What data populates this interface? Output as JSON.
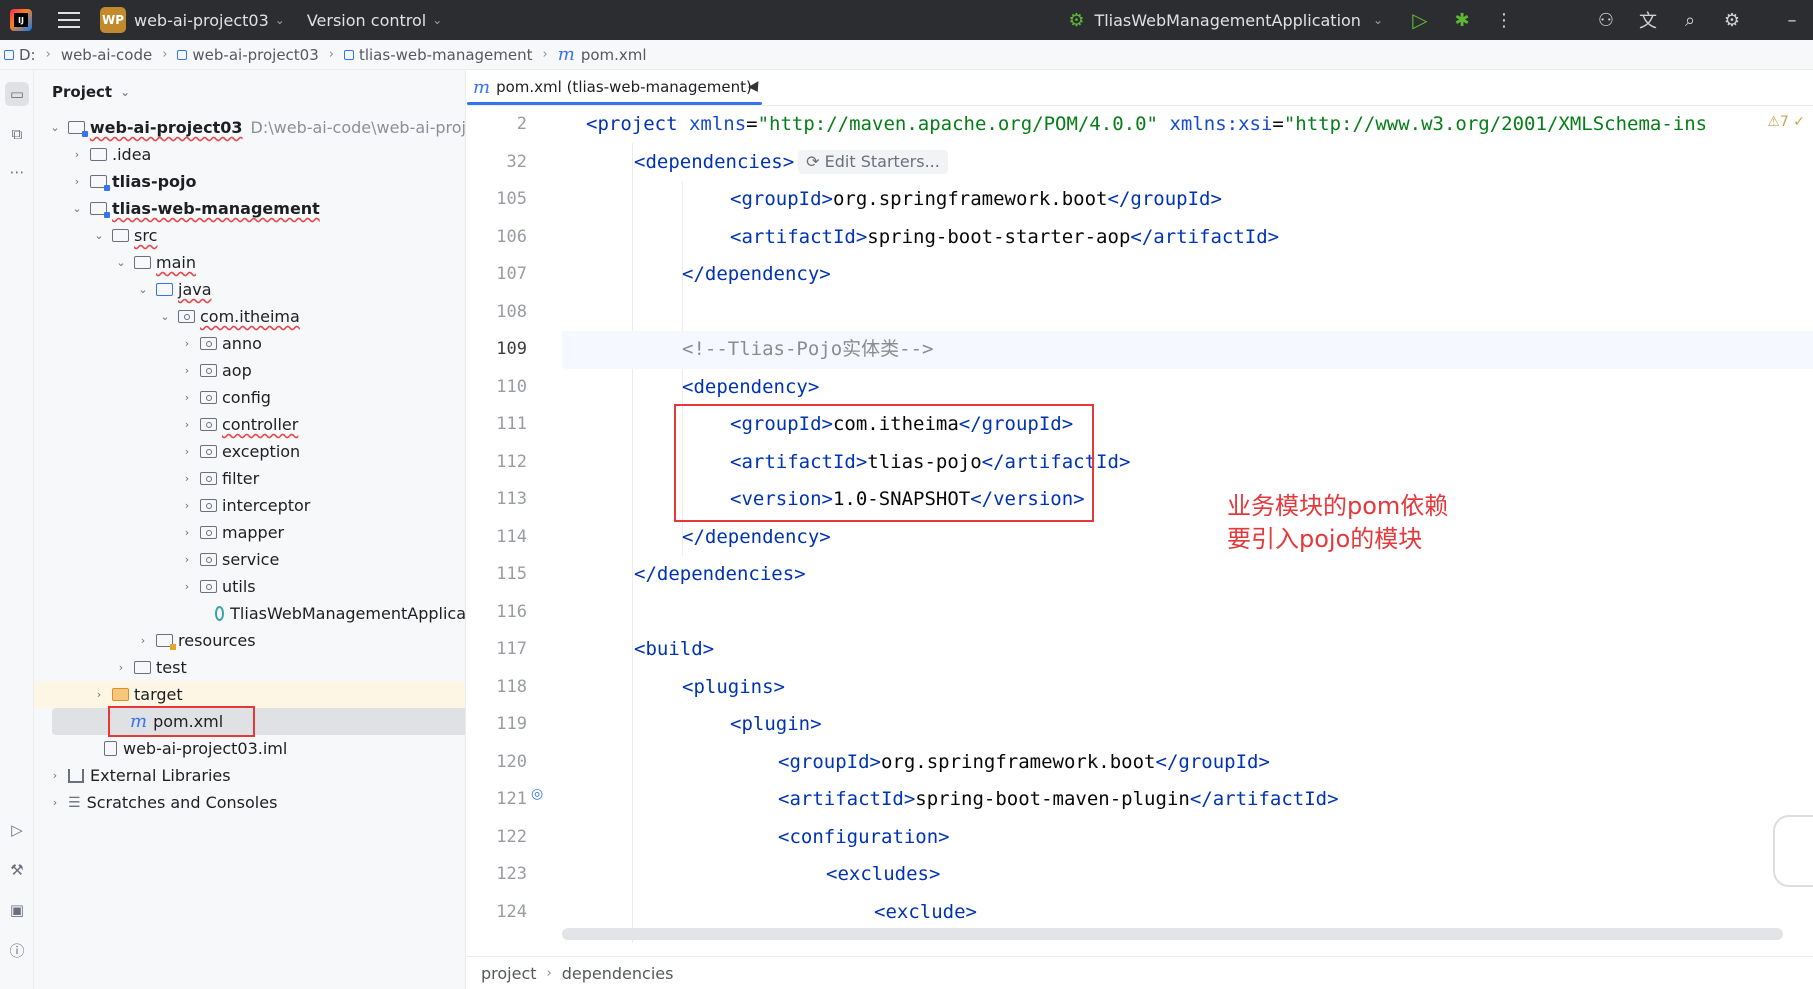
{
  "titlebar": {
    "project_badge": "WP",
    "project_name": "web-ai-project03",
    "version_control": "Version control",
    "run_config": "TliasWebManagementApplication"
  },
  "breadcrumb": [
    "D:",
    "web-ai-code",
    "web-ai-project03",
    "tlias-web-management",
    "pom.xml"
  ],
  "project_panel": {
    "title": "Project",
    "tree": [
      {
        "label": "web-ai-project03",
        "path": "D:\\web-ai-code\\web-ai-proj"
      },
      {
        "label": ".idea"
      },
      {
        "label": "tlias-pojo"
      },
      {
        "label": "tlias-web-management"
      },
      {
        "label": "src"
      },
      {
        "label": "main"
      },
      {
        "label": "java"
      },
      {
        "label": "com.itheima"
      },
      {
        "label": "anno"
      },
      {
        "label": "aop"
      },
      {
        "label": "config"
      },
      {
        "label": "controller"
      },
      {
        "label": "exception"
      },
      {
        "label": "filter"
      },
      {
        "label": "interceptor"
      },
      {
        "label": "mapper"
      },
      {
        "label": "service"
      },
      {
        "label": "utils"
      },
      {
        "label": "TliasWebManagementApplica"
      },
      {
        "label": "resources"
      },
      {
        "label": "test"
      },
      {
        "label": "target"
      },
      {
        "label": "pom.xml"
      },
      {
        "label": "web-ai-project03.iml"
      },
      {
        "label": "External Libraries"
      },
      {
        "label": "Scratches and Consoles"
      }
    ]
  },
  "editor": {
    "tab_label": "pom.xml (tlias-web-management)",
    "warning_count": "7",
    "edit_starters": "Edit Starters...",
    "line_numbers": [
      "2",
      "32",
      "105",
      "106",
      "107",
      "108",
      "109",
      "110",
      "111",
      "112",
      "113",
      "114",
      "115",
      "116",
      "117",
      "118",
      "119",
      "120",
      "121",
      "122",
      "123",
      "124"
    ],
    "annotation_line1": "业务模块的pom依赖",
    "annotation_line2": "要引入pojo的模块",
    "footer_crumbs": [
      "project",
      "dependencies"
    ]
  },
  "code": {
    "l2_tag_open": "<project ",
    "l2_attr1": "xmlns",
    "l2_val1": "\"http://maven.apache.org/POM/4.0.0\"",
    "l2_attr2": "xmlns:xsi",
    "l2_val2": "\"http://www.w3.org/2001/XMLSchema-ins",
    "l32": "<dependencies>",
    "l105_open": "<groupId>",
    "l105_text": "org.springframework.boot",
    "l105_close": "</groupId>",
    "l106_open": "<artifactId>",
    "l106_text": "spring-boot-starter-aop",
    "l106_close": "</artifactId>",
    "l107": "</dependency>",
    "l109": "<!--Tlias-Pojo实体类-->",
    "l110": "<dependency>",
    "l111_open": "<groupId>",
    "l111_text": "com.itheima",
    "l111_close": "</groupId>",
    "l112_open": "<artifactId>",
    "l112_text": "tlias-pojo",
    "l112_close": "</artifactId>",
    "l113_open": "<version>",
    "l113_text": "1.0-SNAPSHOT",
    "l113_close": "</version>",
    "l114": "</dependency>",
    "l115": "</dependencies>",
    "l117": "<build>",
    "l118": "<plugins>",
    "l119": "<plugin>",
    "l120_open": "<groupId>",
    "l120_text": "org.springframework.boot",
    "l120_close": "</groupId>",
    "l121_open": "<artifactId>",
    "l121_text": "spring-boot-maven-plugin",
    "l121_close": "</artifactId>",
    "l122": "<configuration>",
    "l123": "<excludes>",
    "l124": "<exclude>"
  }
}
